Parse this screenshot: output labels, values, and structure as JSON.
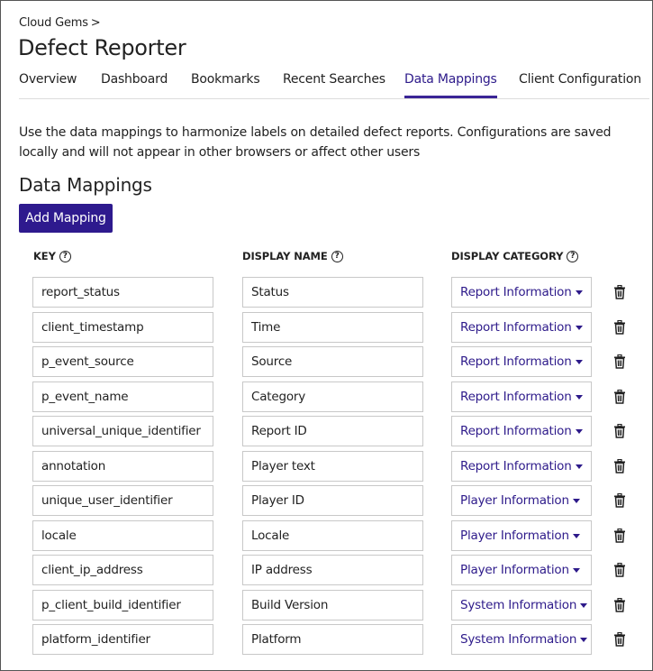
{
  "breadcrumb": {
    "label": "Cloud Gems",
    "separator": ">"
  },
  "page_title": "Defect Reporter",
  "tabs": [
    {
      "label": "Overview",
      "active": false
    },
    {
      "label": "Dashboard",
      "active": false
    },
    {
      "label": "Bookmarks",
      "active": false
    },
    {
      "label": "Recent Searches",
      "active": false
    },
    {
      "label": "Data Mappings",
      "active": true
    },
    {
      "label": "Client Configuration",
      "active": false
    }
  ],
  "description": "Use the data mappings to harmonize labels on detailed defect reports. Configurations are saved locally and will not appear in other browsers or affect other users",
  "section_title": "Data Mappings",
  "add_button_label": "Add Mapping",
  "columns": {
    "key": "KEY",
    "display_name": "DISPLAY NAME",
    "display_category": "DISPLAY CATEGORY",
    "help_glyph": "?"
  },
  "mappings": [
    {
      "key": "report_status",
      "display_name": "Status",
      "category": "Report Information"
    },
    {
      "key": "client_timestamp",
      "display_name": "Time",
      "category": "Report Information"
    },
    {
      "key": "p_event_source",
      "display_name": "Source",
      "category": "Report Information"
    },
    {
      "key": "p_event_name",
      "display_name": "Category",
      "category": "Report Information"
    },
    {
      "key": "universal_unique_identifier",
      "display_name": "Report ID",
      "category": "Report Information"
    },
    {
      "key": "annotation",
      "display_name": "Player text",
      "category": "Report Information"
    },
    {
      "key": "unique_user_identifier",
      "display_name": "Player ID",
      "category": "Player Information"
    },
    {
      "key": "locale",
      "display_name": "Locale",
      "category": "Player Information"
    },
    {
      "key": "client_ip_address",
      "display_name": "IP address",
      "category": "Player Information"
    },
    {
      "key": "p_client_build_identifier",
      "display_name": "Build Version",
      "category": "System Information"
    },
    {
      "key": "platform_identifier",
      "display_name": "Platform",
      "category": "System Information"
    }
  ],
  "colors": {
    "accent": "#2e1a8e",
    "link": "#2d1a8a",
    "border": "#c8c8c8"
  },
  "icons": {
    "row_delete": "trash-icon",
    "category_caret": "caret-down-icon",
    "help": "help-circle-icon"
  }
}
